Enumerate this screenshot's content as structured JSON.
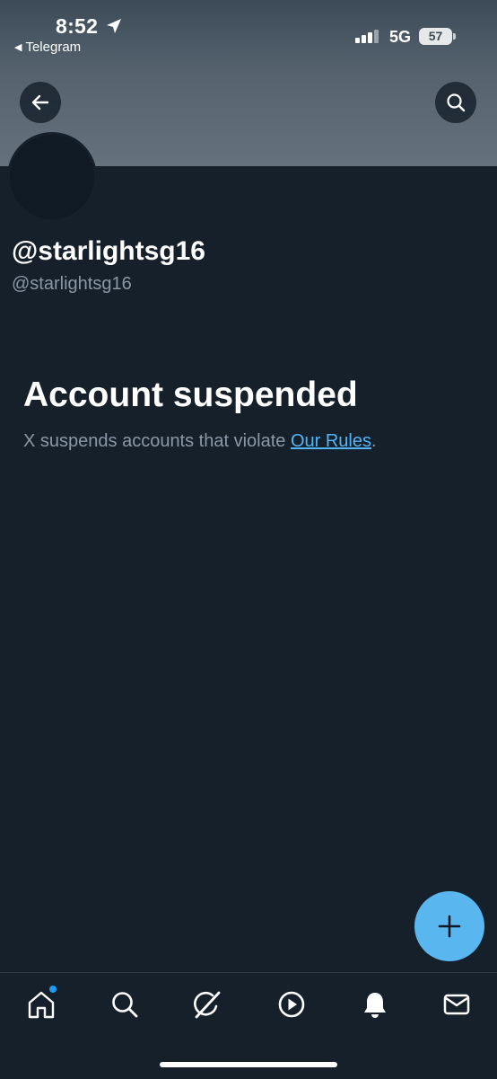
{
  "status_bar": {
    "time": "8:52",
    "back_app_label": "Telegram",
    "network": "5G",
    "battery": "57"
  },
  "profile": {
    "display_name": "@starlightsg16",
    "handle": "@starlightsg16"
  },
  "suspension": {
    "title": "Account suspended",
    "message_prefix": "X suspends accounts that violate ",
    "rules_link": "Our Rules",
    "message_suffix": "."
  },
  "icons": {
    "back": "arrow-left-icon",
    "search": "search-icon",
    "compose": "plus-icon",
    "tabs": [
      "home-icon",
      "search-icon",
      "grok-icon",
      "video-icon",
      "bell-icon",
      "mail-icon"
    ]
  },
  "colors": {
    "background": "#15202b",
    "banner": "#5a6773",
    "accent": "#1d9bf0",
    "fab": "#5ab6ee",
    "secondary_text": "#8b98a5"
  }
}
